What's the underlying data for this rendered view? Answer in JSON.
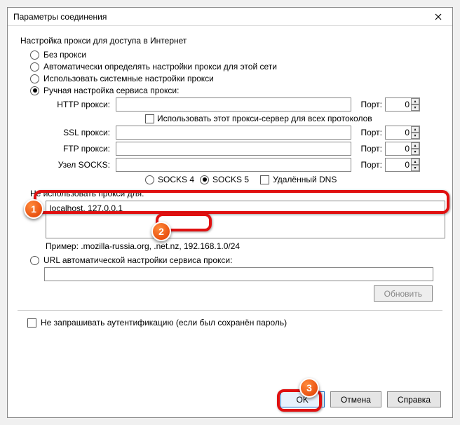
{
  "window": {
    "title": "Параметры соединения"
  },
  "section": {
    "title": "Настройка прокси для доступа в Интернет"
  },
  "radios": {
    "no_proxy": "Без прокси",
    "auto_detect": "Автоматически определять настройки прокси для этой сети",
    "system": "Использовать системные настройки прокси",
    "manual": "Ручная настройка сервиса прокси:",
    "socks4": "SOCKS 4",
    "socks5": "SOCKS 5",
    "auto_url": "URL автоматической настройки сервиса прокси:"
  },
  "labels": {
    "http": "HTTP прокси:",
    "ssl": "SSL прокси:",
    "ftp": "FTP прокси:",
    "socks": "Узел SOCKS:",
    "port": "Порт:",
    "use_for_all": "Использовать этот прокси-сервер для всех протоколов",
    "remote_dns": "Удалённый DNS",
    "no_proxy_for": "Не использовать прокси для:",
    "example": "Пример: .mozilla-russia.org, .net.nz, 192.168.1.0/24",
    "refresh": "Обновить",
    "auth": "Не запрашивать аутентификацию (если был сохранён пароль)",
    "ok": "OK",
    "cancel": "Отмена",
    "help": "Справка"
  },
  "values": {
    "http": "",
    "http_port": "0",
    "ssl": "",
    "ssl_port": "0",
    "ftp": "",
    "ftp_port": "0",
    "socks": "",
    "socks_port": "0",
    "no_proxy_list": "localhost, 127.0.0.1",
    "auto_url": ""
  },
  "callouts": {
    "c1": "1",
    "c2": "2",
    "c3": "3"
  }
}
